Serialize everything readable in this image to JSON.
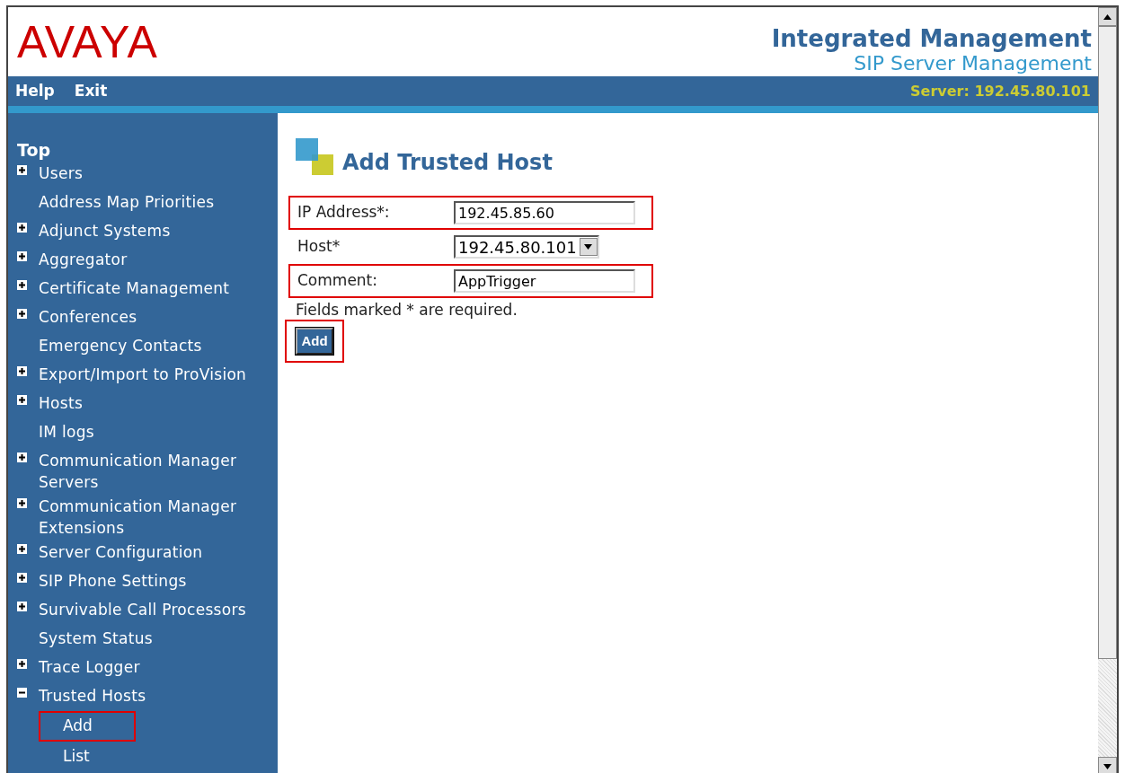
{
  "header": {
    "logo": "AVAYA",
    "title": "Integrated Management",
    "subtitle": "SIP Server Management"
  },
  "nav": {
    "links": [
      "Help",
      "Exit"
    ],
    "server": "Server: 192.45.80.101"
  },
  "sidebar": {
    "heading": "Top",
    "items": [
      {
        "label": "Users",
        "kind": "expandable",
        "expanded": false
      },
      {
        "label": "Address Map Priorities",
        "kind": "leaf"
      },
      {
        "label": "Adjunct Systems",
        "kind": "expandable",
        "expanded": false
      },
      {
        "label": "Aggregator",
        "kind": "expandable",
        "expanded": false
      },
      {
        "label": "Certificate Management",
        "kind": "expandable",
        "expanded": false
      },
      {
        "label": "Conferences",
        "kind": "expandable",
        "expanded": false
      },
      {
        "label": "Emergency Contacts",
        "kind": "leaf"
      },
      {
        "label": "Export/Import to ProVision",
        "kind": "expandable",
        "expanded": false
      },
      {
        "label": "Hosts",
        "kind": "expandable",
        "expanded": false
      },
      {
        "label": "IM logs",
        "kind": "leaf"
      },
      {
        "label": "Communication Manager Servers",
        "kind": "expandable",
        "expanded": false
      },
      {
        "label": "Communication Manager Extensions",
        "kind": "expandable",
        "expanded": false
      },
      {
        "label": "Server Configuration",
        "kind": "expandable",
        "expanded": false
      },
      {
        "label": "SIP Phone Settings",
        "kind": "expandable",
        "expanded": false
      },
      {
        "label": "Survivable Call Processors",
        "kind": "expandable",
        "expanded": false
      },
      {
        "label": "System Status",
        "kind": "leaf"
      },
      {
        "label": "Trace Logger",
        "kind": "expandable",
        "expanded": false
      },
      {
        "label": "Trusted Hosts",
        "kind": "expandable",
        "expanded": true,
        "children": [
          {
            "label": "Add",
            "highlighted": true
          },
          {
            "label": "List",
            "highlighted": false
          }
        ]
      }
    ]
  },
  "form": {
    "title": "Add Trusted Host",
    "fields": [
      {
        "label": "IP Address*:",
        "kind": "text",
        "value": "192.45.85.60",
        "highlighted": true
      },
      {
        "label": "Host*",
        "kind": "select",
        "value": "192.45.80.101",
        "highlighted": false
      },
      {
        "label": "Comment:",
        "kind": "text",
        "value": "AppTrigger",
        "highlighted": true
      }
    ],
    "note": "Fields marked * are required.",
    "button": {
      "label": "Add",
      "highlighted": true
    }
  }
}
